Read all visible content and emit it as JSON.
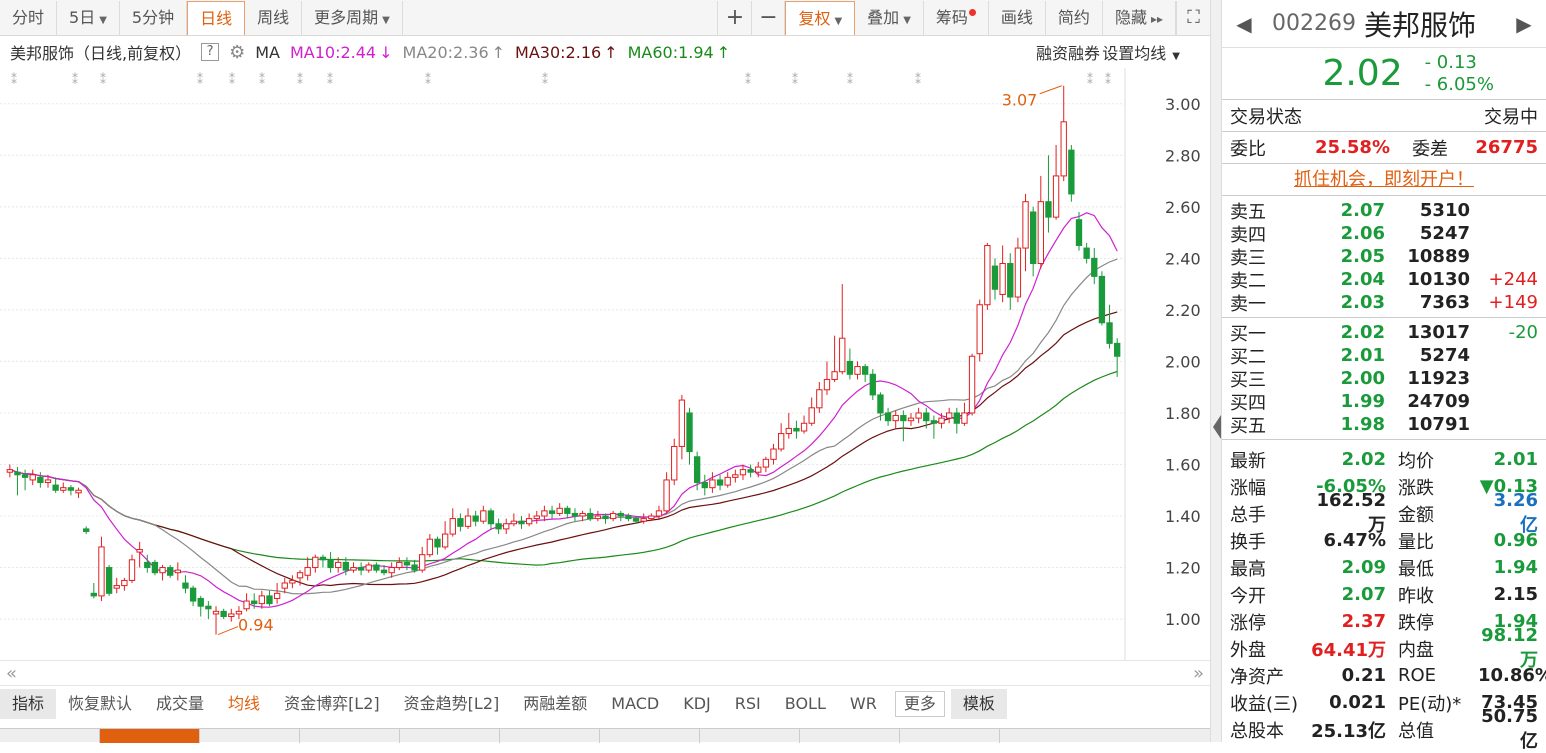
{
  "toolbar": {
    "tabs": [
      {
        "label": "分时",
        "active": false
      },
      {
        "label": "5日",
        "active": false,
        "dropdown": true
      },
      {
        "label": "5分钟",
        "active": false
      },
      {
        "label": "日线",
        "active": true
      },
      {
        "label": "周线",
        "active": false
      },
      {
        "label": "更多周期",
        "active": false,
        "dropdown": true
      }
    ],
    "zoom_in": "+",
    "zoom_out": "−",
    "right_items": [
      {
        "label": "复权",
        "dropdown": true,
        "highlight": true
      },
      {
        "label": "叠加",
        "dropdown": true
      },
      {
        "label": "筹码",
        "dot": true
      },
      {
        "label": "画线"
      },
      {
        "label": "简约"
      },
      {
        "label": "隐藏",
        "suffix": "▸▸"
      }
    ]
  },
  "ma_bar": {
    "title": "美邦服饰（日线,前复权）",
    "help": "?",
    "ma_label": "MA",
    "ma10": "MA10:2.44",
    "ma20": "MA20:2.36",
    "ma30": "MA30:2.16",
    "ma60": "MA60:1.94",
    "ma10_arrow": "↓",
    "ma20_arrow": "↑",
    "ma30_arrow": "↑",
    "ma60_arrow": "↑",
    "margin_label": "融资融券",
    "set_ma_label": "设置均线"
  },
  "colors": {
    "up": "#e02020",
    "down": "#1a9a3a",
    "ma10": "#d020d0",
    "ma20": "#888888",
    "ma30": "#6a1010",
    "ma60": "#1a8a1a",
    "accent": "#e06010"
  },
  "chart_data": {
    "type": "candlestick",
    "y_ticks": [
      "3.00",
      "2.80",
      "2.60",
      "2.40",
      "2.20",
      "2.00",
      "1.80",
      "1.60",
      "1.40",
      "1.20",
      "1.00"
    ],
    "ylim": [
      0.88,
      3.1
    ],
    "high_label": "3.07",
    "low_label": "0.94",
    "candles": [
      [
        1.57,
        1.58,
        1.6,
        1.55
      ],
      [
        1.57,
        1.56,
        1.59,
        1.48
      ],
      [
        1.56,
        1.55,
        1.58,
        1.5
      ],
      [
        1.54,
        1.56,
        1.58,
        1.52
      ],
      [
        1.55,
        1.53,
        1.57,
        1.51
      ],
      [
        1.53,
        1.54,
        1.56,
        1.51
      ],
      [
        1.52,
        1.5,
        1.55,
        1.49
      ],
      [
        1.5,
        1.51,
        1.53,
        1.49
      ],
      [
        1.51,
        1.5,
        1.52,
        1.48
      ],
      [
        1.49,
        1.5,
        1.51,
        1.47
      ],
      [
        1.35,
        1.34,
        1.36,
        1.33
      ],
      [
        1.1,
        1.09,
        1.14,
        1.08
      ],
      [
        1.09,
        1.28,
        1.32,
        1.07
      ],
      [
        1.2,
        1.1,
        1.21,
        1.09
      ],
      [
        1.12,
        1.13,
        1.16,
        1.1
      ],
      [
        1.13,
        1.15,
        1.16,
        1.11
      ],
      [
        1.15,
        1.23,
        1.25,
        1.14
      ],
      [
        1.26,
        1.27,
        1.3,
        1.2
      ],
      [
        1.22,
        1.2,
        1.25,
        1.18
      ],
      [
        1.22,
        1.18,
        1.23,
        1.17
      ],
      [
        1.18,
        1.2,
        1.21,
        1.15
      ],
      [
        1.2,
        1.17,
        1.21,
        1.16
      ],
      [
        1.18,
        1.19,
        1.22,
        1.15
      ],
      [
        1.14,
        1.12,
        1.17,
        1.1
      ],
      [
        1.12,
        1.07,
        1.13,
        1.05
      ],
      [
        1.08,
        1.05,
        1.09,
        1.01
      ],
      [
        1.05,
        1.04,
        1.07,
        1.0
      ],
      [
        1.02,
        1.03,
        1.05,
        0.94
      ],
      [
        1.03,
        1.01,
        1.04,
        1.0
      ],
      [
        1.01,
        1.02,
        1.04,
        0.99
      ],
      [
        1.02,
        1.03,
        1.05,
        1.0
      ],
      [
        1.04,
        1.07,
        1.1,
        1.03
      ],
      [
        1.07,
        1.06,
        1.1,
        1.04
      ],
      [
        1.06,
        1.09,
        1.11,
        1.04
      ],
      [
        1.09,
        1.06,
        1.11,
        1.05
      ],
      [
        1.08,
        1.1,
        1.14,
        1.06
      ],
      [
        1.12,
        1.14,
        1.16,
        1.1
      ],
      [
        1.14,
        1.15,
        1.17,
        1.12
      ],
      [
        1.16,
        1.18,
        1.19,
        1.13
      ],
      [
        1.17,
        1.2,
        1.24,
        1.15
      ],
      [
        1.2,
        1.24,
        1.25,
        1.18
      ],
      [
        1.24,
        1.23,
        1.25,
        1.2
      ],
      [
        1.23,
        1.2,
        1.26,
        1.18
      ],
      [
        1.2,
        1.22,
        1.24,
        1.18
      ],
      [
        1.22,
        1.19,
        1.24,
        1.17
      ],
      [
        1.19,
        1.2,
        1.22,
        1.18
      ],
      [
        1.2,
        1.19,
        1.22,
        1.17
      ],
      [
        1.19,
        1.21,
        1.22,
        1.18
      ],
      [
        1.21,
        1.19,
        1.22,
        1.18
      ],
      [
        1.19,
        1.18,
        1.21,
        1.17
      ],
      [
        1.18,
        1.2,
        1.22,
        1.16
      ],
      [
        1.2,
        1.22,
        1.24,
        1.19
      ],
      [
        1.22,
        1.21,
        1.24,
        1.19
      ],
      [
        1.21,
        1.19,
        1.23,
        1.18
      ],
      [
        1.19,
        1.25,
        1.28,
        1.18
      ],
      [
        1.25,
        1.31,
        1.33,
        1.24
      ],
      [
        1.31,
        1.28,
        1.32,
        1.25
      ],
      [
        1.28,
        1.33,
        1.38,
        1.27
      ],
      [
        1.33,
        1.39,
        1.43,
        1.32
      ],
      [
        1.39,
        1.36,
        1.41,
        1.34
      ],
      [
        1.36,
        1.4,
        1.43,
        1.35
      ],
      [
        1.4,
        1.38,
        1.42,
        1.36
      ],
      [
        1.38,
        1.42,
        1.44,
        1.37
      ],
      [
        1.42,
        1.37,
        1.43,
        1.35
      ],
      [
        1.37,
        1.35,
        1.39,
        1.33
      ],
      [
        1.35,
        1.37,
        1.39,
        1.33
      ],
      [
        1.37,
        1.38,
        1.41,
        1.36
      ],
      [
        1.38,
        1.37,
        1.4,
        1.35
      ],
      [
        1.37,
        1.39,
        1.41,
        1.36
      ],
      [
        1.39,
        1.4,
        1.42,
        1.37
      ],
      [
        1.4,
        1.42,
        1.44,
        1.38
      ],
      [
        1.42,
        1.41,
        1.44,
        1.39
      ],
      [
        1.41,
        1.43,
        1.45,
        1.4
      ],
      [
        1.43,
        1.41,
        1.44,
        1.39
      ],
      [
        1.41,
        1.4,
        1.43,
        1.38
      ],
      [
        1.4,
        1.41,
        1.42,
        1.38
      ],
      [
        1.41,
        1.39,
        1.43,
        1.38
      ],
      [
        1.39,
        1.4,
        1.42,
        1.38
      ],
      [
        1.4,
        1.39,
        1.41,
        1.37
      ],
      [
        1.39,
        1.41,
        1.42,
        1.38
      ],
      [
        1.41,
        1.4,
        1.42,
        1.38
      ],
      [
        1.4,
        1.39,
        1.41,
        1.38
      ],
      [
        1.39,
        1.38,
        1.4,
        1.37
      ],
      [
        1.38,
        1.39,
        1.41,
        1.37
      ],
      [
        1.39,
        1.4,
        1.41,
        1.38
      ],
      [
        1.4,
        1.42,
        1.44,
        1.39
      ],
      [
        1.42,
        1.54,
        1.57,
        1.41
      ],
      [
        1.54,
        1.67,
        1.7,
        1.52
      ],
      [
        1.67,
        1.85,
        1.87,
        1.62
      ],
      [
        1.8,
        1.65,
        1.82,
        1.6
      ],
      [
        1.63,
        1.53,
        1.65,
        1.5
      ],
      [
        1.53,
        1.51,
        1.56,
        1.48
      ],
      [
        1.51,
        1.54,
        1.57,
        1.49
      ],
      [
        1.54,
        1.52,
        1.56,
        1.5
      ],
      [
        1.52,
        1.55,
        1.57,
        1.51
      ],
      [
        1.55,
        1.56,
        1.58,
        1.53
      ],
      [
        1.56,
        1.58,
        1.6,
        1.54
      ],
      [
        1.58,
        1.57,
        1.6,
        1.55
      ],
      [
        1.57,
        1.59,
        1.61,
        1.55
      ],
      [
        1.59,
        1.62,
        1.63,
        1.57
      ],
      [
        1.62,
        1.66,
        1.68,
        1.6
      ],
      [
        1.66,
        1.72,
        1.76,
        1.65
      ],
      [
        1.72,
        1.74,
        1.8,
        1.7
      ],
      [
        1.74,
        1.73,
        1.77,
        1.7
      ],
      [
        1.73,
        1.76,
        1.79,
        1.72
      ],
      [
        1.76,
        1.82,
        1.86,
        1.75
      ],
      [
        1.82,
        1.89,
        1.92,
        1.8
      ],
      [
        1.89,
        1.93,
        2.0,
        1.87
      ],
      [
        1.93,
        1.96,
        2.1,
        1.92
      ],
      [
        1.96,
        2.09,
        2.3,
        1.95
      ],
      [
        2.0,
        1.95,
        2.05,
        1.93
      ],
      [
        1.95,
        1.98,
        2.0,
        1.93
      ],
      [
        1.98,
        1.95,
        1.99,
        1.92
      ],
      [
        1.95,
        1.87,
        1.97,
        1.85
      ],
      [
        1.87,
        1.8,
        1.88,
        1.77
      ],
      [
        1.8,
        1.77,
        1.82,
        1.75
      ],
      [
        1.77,
        1.79,
        1.81,
        1.74
      ],
      [
        1.79,
        1.77,
        1.81,
        1.69
      ],
      [
        1.77,
        1.78,
        1.8,
        1.75
      ],
      [
        1.78,
        1.8,
        1.82,
        1.76
      ],
      [
        1.8,
        1.77,
        1.82,
        1.74
      ],
      [
        1.77,
        1.76,
        1.79,
        1.7
      ],
      [
        1.76,
        1.78,
        1.8,
        1.74
      ],
      [
        1.78,
        1.8,
        1.82,
        1.76
      ],
      [
        1.8,
        1.76,
        1.82,
        1.72
      ],
      [
        1.76,
        1.8,
        1.84,
        1.75
      ],
      [
        1.8,
        2.02,
        2.03,
        1.79
      ],
      [
        2.03,
        2.22,
        2.24,
        2.0
      ],
      [
        2.22,
        2.45,
        2.46,
        2.2
      ],
      [
        2.37,
        2.28,
        2.4,
        2.24
      ],
      [
        2.26,
        2.38,
        2.45,
        2.23
      ],
      [
        2.38,
        2.25,
        2.42,
        2.2
      ],
      [
        2.25,
        2.44,
        2.48,
        2.23
      ],
      [
        2.44,
        2.62,
        2.65,
        2.35
      ],
      [
        2.58,
        2.38,
        2.6,
        2.33
      ],
      [
        2.38,
        2.62,
        2.72,
        2.36
      ],
      [
        2.62,
        2.56,
        2.8,
        2.5
      ],
      [
        2.56,
        2.72,
        2.84,
        2.55
      ],
      [
        2.72,
        2.93,
        3.07,
        2.7
      ],
      [
        2.82,
        2.65,
        2.84,
        2.62
      ],
      [
        2.55,
        2.45,
        2.58,
        2.43
      ],
      [
        2.44,
        2.4,
        2.46,
        2.38
      ],
      [
        2.4,
        2.33,
        2.44,
        2.3
      ],
      [
        2.33,
        2.15,
        2.35,
        2.14
      ],
      [
        2.15,
        2.07,
        2.22,
        2.05
      ],
      [
        2.07,
        2.02,
        2.09,
        1.94
      ]
    ]
  },
  "scroll": {
    "left": "«",
    "right": "»"
  },
  "indicators": [
    {
      "label": "指标",
      "active": true
    },
    {
      "label": "恢复默认"
    },
    {
      "label": "成交量"
    },
    {
      "label": "均线",
      "highlight": true
    },
    {
      "label": "资金博弈[L2]"
    },
    {
      "label": "资金趋势[L2]"
    },
    {
      "label": "两融差额"
    },
    {
      "label": "MACD"
    },
    {
      "label": "KDJ"
    },
    {
      "label": "RSI"
    },
    {
      "label": "BOLL"
    },
    {
      "label": "WR"
    },
    {
      "label": "更多",
      "box": true
    },
    {
      "label": "模板",
      "active": true
    }
  ],
  "panel": {
    "nav_prev": "◀",
    "nav_next": "▶",
    "code": "002269",
    "name": "美邦服饰",
    "price": "2.02",
    "change": "- 0.13",
    "change_pct": "- 6.05%",
    "status_label": "交易状态",
    "status_value": "交易中",
    "wb_label": "委比",
    "wb_value": "25.58%",
    "wc_label": "委差",
    "wc_value": "26775",
    "promo": "抓住机会，即刻开户！",
    "asks": [
      {
        "label": "卖五",
        "price": "2.07",
        "vol": "5310",
        "chg": ""
      },
      {
        "label": "卖四",
        "price": "2.06",
        "vol": "5247",
        "chg": ""
      },
      {
        "label": "卖三",
        "price": "2.05",
        "vol": "10889",
        "chg": ""
      },
      {
        "label": "卖二",
        "price": "2.04",
        "vol": "10130",
        "chg": "+244"
      },
      {
        "label": "卖一",
        "price": "2.03",
        "vol": "7363",
        "chg": "+149"
      }
    ],
    "bids": [
      {
        "label": "买一",
        "price": "2.02",
        "vol": "13017",
        "chg": "-20"
      },
      {
        "label": "买二",
        "price": "2.01",
        "vol": "5274",
        "chg": ""
      },
      {
        "label": "买三",
        "price": "2.00",
        "vol": "11923",
        "chg": ""
      },
      {
        "label": "买四",
        "price": "1.99",
        "vol": "24709",
        "chg": ""
      },
      {
        "label": "买五",
        "price": "1.98",
        "vol": "10791",
        "chg": ""
      }
    ],
    "stats": [
      {
        "l": "最新",
        "v": "2.02",
        "vc": "grn",
        "l2": "均价",
        "v2": "2.01",
        "v2c": "grn"
      },
      {
        "l": "涨幅",
        "v": "-6.05%",
        "vc": "grn",
        "l2": "涨跌",
        "v2": "▼0.13",
        "v2c": "grn"
      },
      {
        "l": "总手",
        "v": "162.52万",
        "vc": "",
        "l2": "金额",
        "v2": "3.26亿",
        "v2c": "blu"
      },
      {
        "l": "换手",
        "v": "6.47%",
        "vc": "",
        "l2": "量比",
        "v2": "0.96",
        "v2c": "grn"
      },
      {
        "l": "最高",
        "v": "2.09",
        "vc": "grn",
        "l2": "最低",
        "v2": "1.94",
        "v2c": "grn"
      },
      {
        "l": "今开",
        "v": "2.07",
        "vc": "grn",
        "l2": "昨收",
        "v2": "2.15",
        "v2c": ""
      },
      {
        "l": "涨停",
        "v": "2.37",
        "vc": "red",
        "l2": "跌停",
        "v2": "1.94",
        "v2c": "grn"
      },
      {
        "l": "外盘",
        "v": "64.41万",
        "vc": "red",
        "l2": "内盘",
        "v2": "98.12万",
        "v2c": "grn"
      },
      {
        "l": "净资产",
        "v": "0.21",
        "vc": "",
        "l2": "ROE",
        "v2": "10.86%",
        "v2c": ""
      },
      {
        "l": "收益(三)",
        "v": "0.021",
        "vc": "",
        "l2": "PE(动)*",
        "v2": "73.45",
        "v2c": ""
      },
      {
        "l": "总股本",
        "v": "25.13亿",
        "vc": "",
        "l2": "总值",
        "v2": "50.75亿",
        "v2c": ""
      }
    ]
  }
}
